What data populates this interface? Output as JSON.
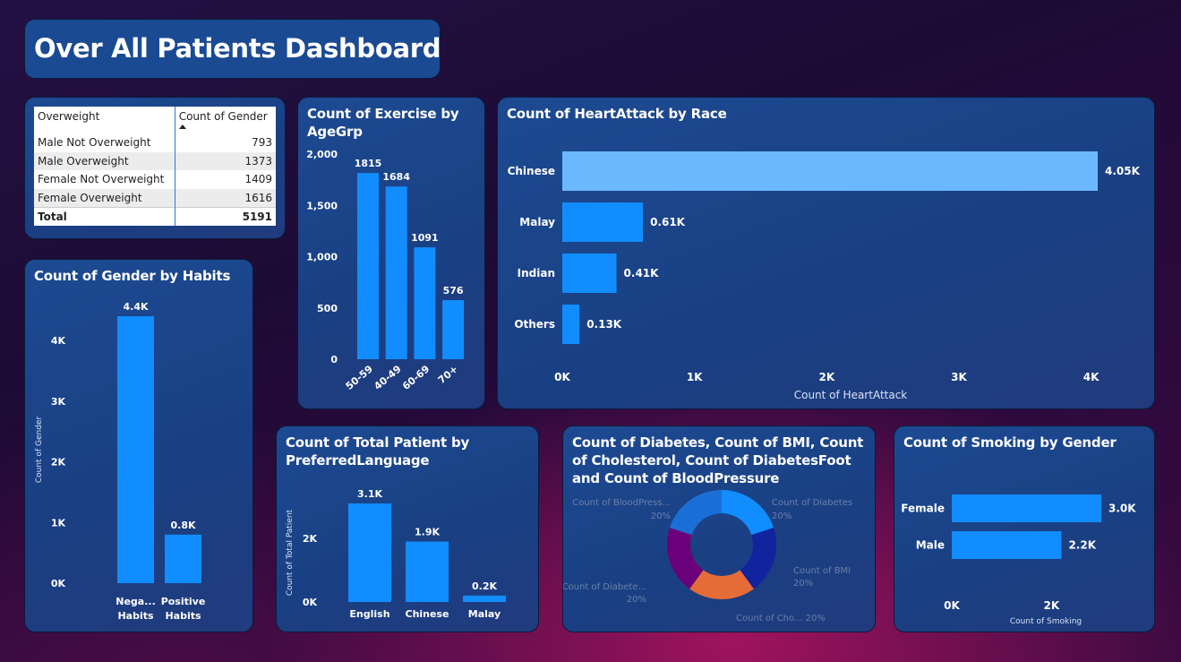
{
  "dashboard_title": "Over All Patients Dashboard",
  "table": {
    "headers": [
      "Overweight",
      "Count of Gender"
    ],
    "rows": [
      {
        "label": "Male Not Overweight",
        "value": "793"
      },
      {
        "label": "Male Overweight",
        "value": "1373"
      },
      {
        "label": "Female Not Overweight",
        "value": "1409"
      },
      {
        "label": "Female Overweight",
        "value": "1616"
      }
    ],
    "total_label": "Total",
    "total_value": "5191"
  },
  "colors": {
    "bar": "#118dff",
    "bar_highlight": "#6cb8ff",
    "panel": "#1c4a92",
    "donut": [
      "#118dff",
      "#12239e",
      "#e66c37",
      "#6b007b",
      "#1a6fd6"
    ]
  },
  "chart_data": [
    {
      "type": "bar",
      "title": "Count of Gender by Habits",
      "categories": [
        "Nega... Habits",
        "Positive Habits"
      ],
      "category_lines": [
        [
          "Nega...",
          "Habits"
        ],
        [
          "Positive",
          "Habits"
        ]
      ],
      "values": [
        4400,
        800
      ],
      "data_labels": [
        "4.4K",
        "0.8K"
      ],
      "ylabel": "Count of Gender",
      "xlabel": "",
      "yticks": [
        "0K",
        "1K",
        "2K",
        "3K",
        "4K"
      ],
      "ytick_values": [
        0,
        1000,
        2000,
        3000,
        4000
      ],
      "ylim": [
        0,
        4400
      ]
    },
    {
      "type": "bar",
      "title": "Count of Exercise by AgeGrp",
      "categories": [
        "50-59",
        "40-49",
        "60-69",
        "70+"
      ],
      "values": [
        1815,
        1684,
        1091,
        576
      ],
      "data_labels": [
        "1815",
        "1684",
        "1091",
        "576"
      ],
      "yticks": [
        "0",
        "500",
        "1,000",
        "1,500",
        "2,000"
      ],
      "ytick_values": [
        0,
        500,
        1000,
        1500,
        2000
      ],
      "ylim": [
        0,
        2000
      ]
    },
    {
      "type": "bar",
      "orientation": "horizontal",
      "title": "Count of HeartAttack by Race",
      "categories": [
        "Chinese",
        "Malay",
        "Indian",
        "Others"
      ],
      "values": [
        4050,
        610,
        410,
        130
      ],
      "data_labels": [
        "4.05K",
        "0.61K",
        "0.41K",
        "0.13K"
      ],
      "highlight_index": 0,
      "xlabel": "Count of HeartAttack",
      "xticks": [
        "0K",
        "1K",
        "2K",
        "3K",
        "4K"
      ],
      "xtick_values": [
        0,
        1000,
        2000,
        3000,
        4000
      ],
      "xlim": [
        0,
        4050
      ]
    },
    {
      "type": "bar",
      "title": "Count of Total Patient by PreferredLanguage",
      "categories": [
        "English",
        "Chinese",
        "Malay"
      ],
      "values": [
        3100,
        1900,
        200
      ],
      "data_labels": [
        "3.1K",
        "1.9K",
        "0.2K"
      ],
      "ylabel": "Count of Total Patient",
      "yticks": [
        "0K",
        "2K"
      ],
      "ytick_values": [
        0,
        2000
      ],
      "ylim": [
        0,
        3100
      ]
    },
    {
      "type": "pie",
      "donut": true,
      "title": "Count of Diabetes, Count of BMI, Count of Cholesterol, Count of DiabetesFoot and Count of BloodPressure",
      "slices": [
        {
          "label": "Count of Diabetes",
          "percent": 20
        },
        {
          "label": "Count of BMI",
          "percent": 20
        },
        {
          "label": "Count of Cho...",
          "percent": 20
        },
        {
          "label": "Count of Diabete...",
          "percent": 20
        },
        {
          "label": "Count of BloodPress...",
          "percent": 20
        }
      ],
      "percent_labels": [
        "20%",
        "20%",
        "20%",
        "20%",
        "20%"
      ]
    },
    {
      "type": "bar",
      "orientation": "horizontal",
      "title": "Count of Smoking by Gender",
      "categories": [
        "Female",
        "Male"
      ],
      "values": [
        3000,
        2200
      ],
      "data_labels": [
        "3.0K",
        "2.2K"
      ],
      "xlabel": "Count of Smoking",
      "xticks": [
        "0K",
        "2K"
      ],
      "xtick_values": [
        0,
        2000
      ],
      "xlim": [
        0,
        3000
      ]
    }
  ]
}
